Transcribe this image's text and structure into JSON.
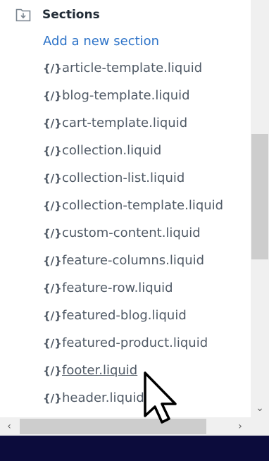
{
  "sidebar": {
    "title": "Sections",
    "add_link": "Add a new section",
    "file_icon": "{/}",
    "files": [
      "article-template.liquid",
      "blog-template.liquid",
      "cart-template.liquid",
      "collection.liquid",
      "collection-list.liquid",
      "collection-template.liquid",
      "custom-content.liquid",
      "feature-columns.liquid",
      "feature-row.liquid",
      "featured-blog.liquid",
      "featured-product.liquid",
      "footer.liquid",
      "header.liquid"
    ],
    "hovered_file": "footer.liquid"
  },
  "scrollbars": {
    "down_arrow": "⌄",
    "left_arrow": "‹",
    "right_arrow": "›"
  },
  "icons": {
    "folder": "folder-download-icon",
    "cursor": "mouse-pointer-icon"
  },
  "colors": {
    "link": "#2d73c8",
    "text": "#505a66",
    "heading": "#212b36",
    "taskbar": "#0c0c3c"
  }
}
